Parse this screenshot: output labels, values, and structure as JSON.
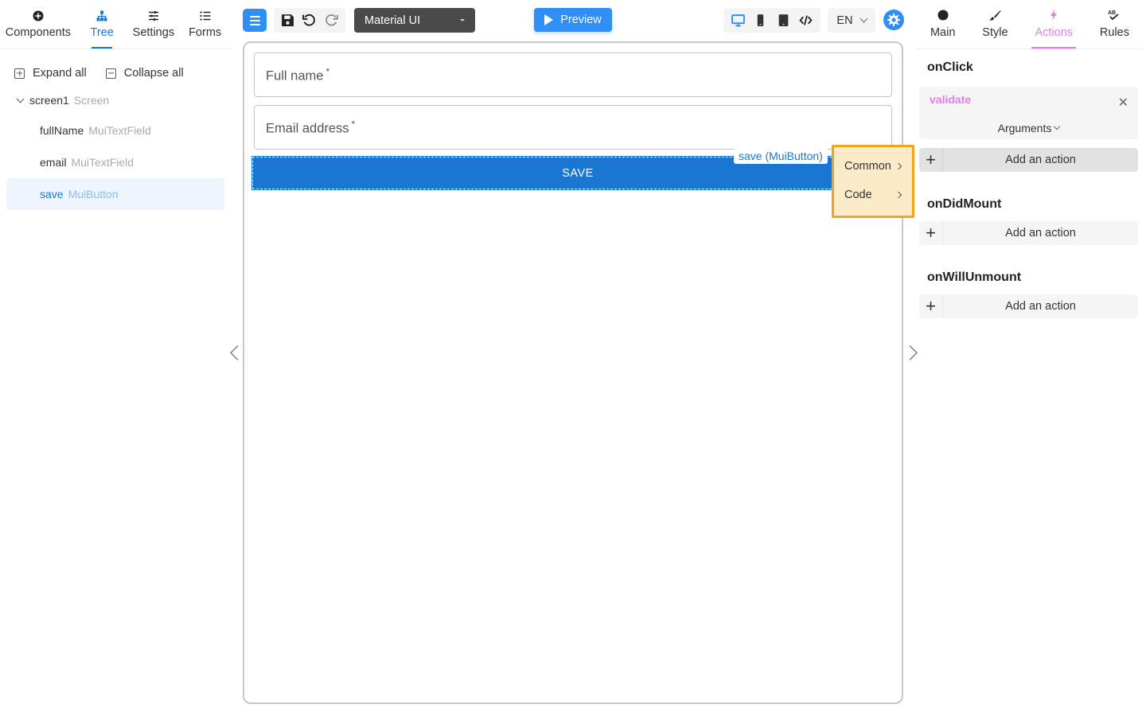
{
  "left_tabs": [
    {
      "label": "Components",
      "icon": "plus-circle-icon"
    },
    {
      "label": "Tree",
      "icon": "tree-icon",
      "active": true
    },
    {
      "label": "Settings",
      "icon": "sliders-icon"
    },
    {
      "label": "Forms",
      "icon": "list-icon"
    }
  ],
  "tree_actions": {
    "expand": "Expand all",
    "collapse": "Collapse all"
  },
  "tree": {
    "root": {
      "name": "screen1",
      "type": "Screen"
    },
    "children": [
      {
        "name": "fullName",
        "type": "MuiTextField"
      },
      {
        "name": "email",
        "type": "MuiTextField"
      },
      {
        "name": "save",
        "type": "MuiButton",
        "selected": true
      }
    ]
  },
  "toolbar": {
    "library": "Material UI",
    "preview": "Preview",
    "language": "EN"
  },
  "canvas": {
    "fields": [
      {
        "label": "Full name",
        "required_mark": "*"
      },
      {
        "label": "Email address",
        "required_mark": "*"
      }
    ],
    "button_label": "SAVE",
    "selection_label": "save (MuiButton)"
  },
  "context_menu": [
    "Common",
    "Code"
  ],
  "right_tabs": [
    {
      "label": "Main",
      "icon": "circle-icon"
    },
    {
      "label": "Style",
      "icon": "brush-icon"
    },
    {
      "label": "Actions",
      "icon": "lightning-icon",
      "active": true
    },
    {
      "label": "Rules",
      "icon": "rules-icon"
    }
  ],
  "events": {
    "onClick": {
      "title": "onClick",
      "action": "validate",
      "arguments": "Arguments",
      "add": "Add an action"
    },
    "onDidMount": {
      "title": "onDidMount",
      "add": "Add an action"
    },
    "onWillUnmount": {
      "title": "onWillUnmount",
      "add": "Add an action"
    }
  },
  "colors": {
    "accent": "#1976d2",
    "actions_accent": "#e27de7",
    "highlight": "#f2a31a"
  }
}
